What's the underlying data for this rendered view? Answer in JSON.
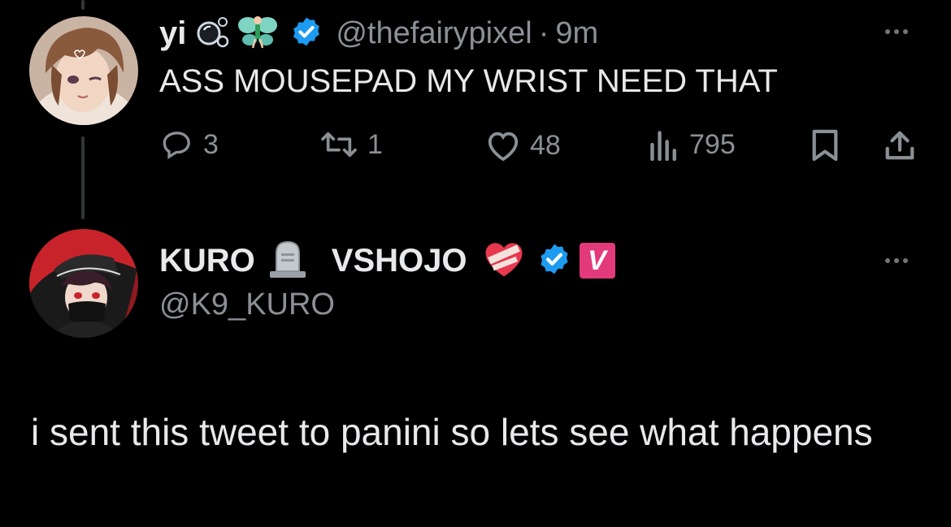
{
  "colors": {
    "background": "#000000",
    "text": "#e7e9ea",
    "secondary": "#8b9096",
    "verified": "#1d9bf0",
    "vshojo_badge": "#e23a7b"
  },
  "tweet": {
    "author_name": "yi",
    "author_emojis": [
      "bubbles-icon",
      "fairy-icon"
    ],
    "handle": "@thefairypixel",
    "separator": "·",
    "time": "9m",
    "text": "ASS MOUSEPAD MY WRIST NEED THAT",
    "actions": {
      "replies": "3",
      "retweets": "1",
      "likes": "48",
      "views": "795"
    }
  },
  "reply": {
    "author_name_1": "KURO",
    "author_name_2": "VSHOJO",
    "badge_letter": "V",
    "handle": "@K9_KURO",
    "text": "i sent this tweet to panini so lets see what happens"
  }
}
